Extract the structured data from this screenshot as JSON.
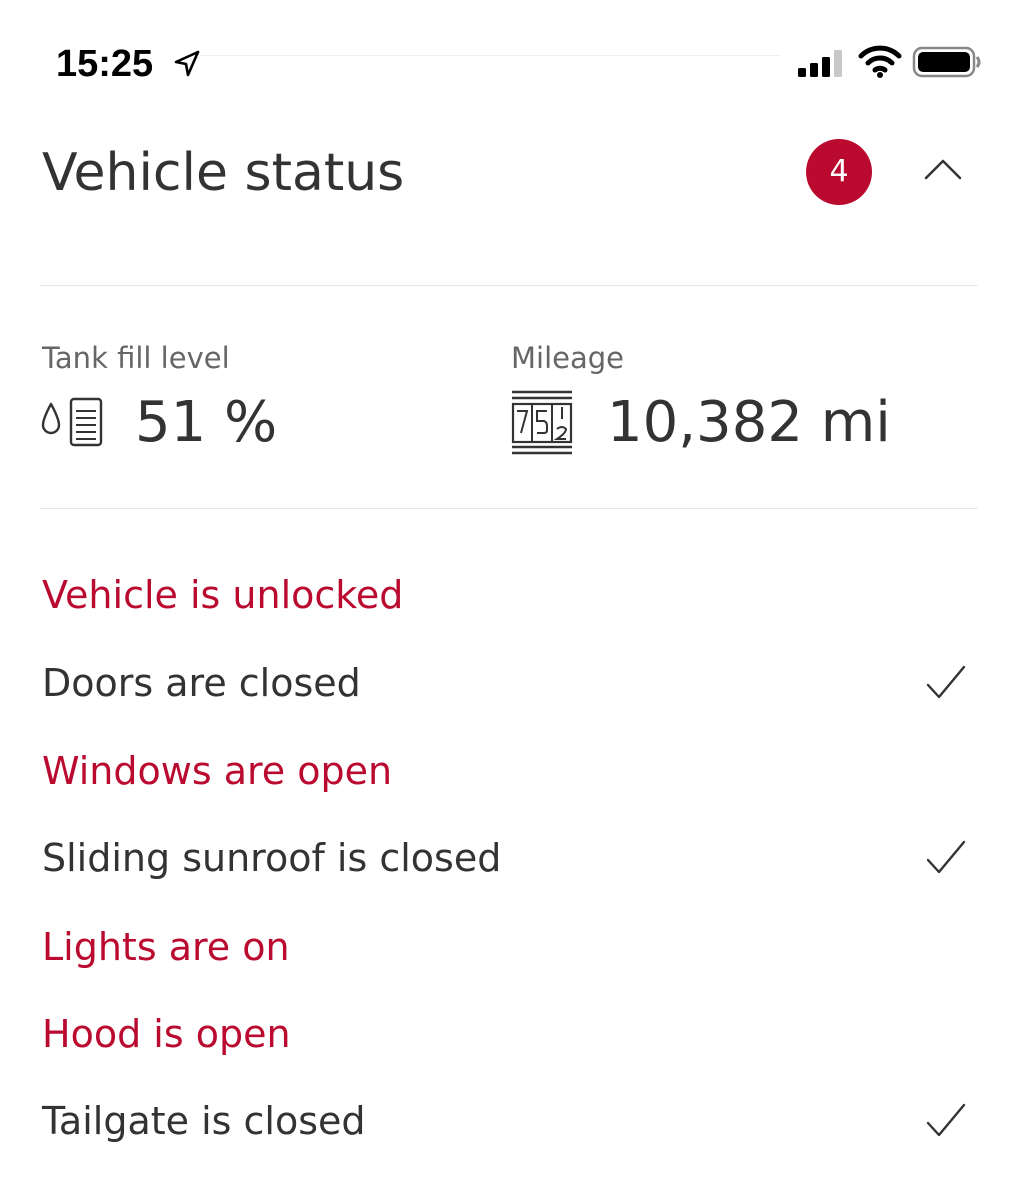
{
  "status_bar": {
    "time": "15:25",
    "icons": [
      "location-arrow-icon",
      "cellular-signal-icon",
      "wifi-icon",
      "battery-icon"
    ]
  },
  "header": {
    "title": "Vehicle status",
    "badge_count": "4",
    "collapse_icon": "chevron-up-icon"
  },
  "stats": {
    "tank": {
      "label": "Tank fill level",
      "value": "51 %",
      "icon": "fuel-tank-icon"
    },
    "mileage": {
      "label": "Mileage",
      "value": "10,382 mi",
      "icon": "odometer-icon"
    }
  },
  "status_items": [
    {
      "text": "Vehicle is unlocked",
      "state": "alert"
    },
    {
      "text": "Doors are closed",
      "state": "ok",
      "icon": "checkmark-icon"
    },
    {
      "text": "Windows are open",
      "state": "alert"
    },
    {
      "text": "Sliding sunroof is closed",
      "state": "ok",
      "icon": "checkmark-icon"
    },
    {
      "text": "Lights are on",
      "state": "alert"
    },
    {
      "text": "Hood is open",
      "state": "alert"
    },
    {
      "text": "Tailgate is closed",
      "state": "ok",
      "icon": "checkmark-icon"
    }
  ],
  "colors": {
    "alert": "#bb0a30",
    "text": "#333333",
    "muted": "#666666",
    "divider": "#e6e6e6",
    "badge_bg": "#bb0a30"
  }
}
